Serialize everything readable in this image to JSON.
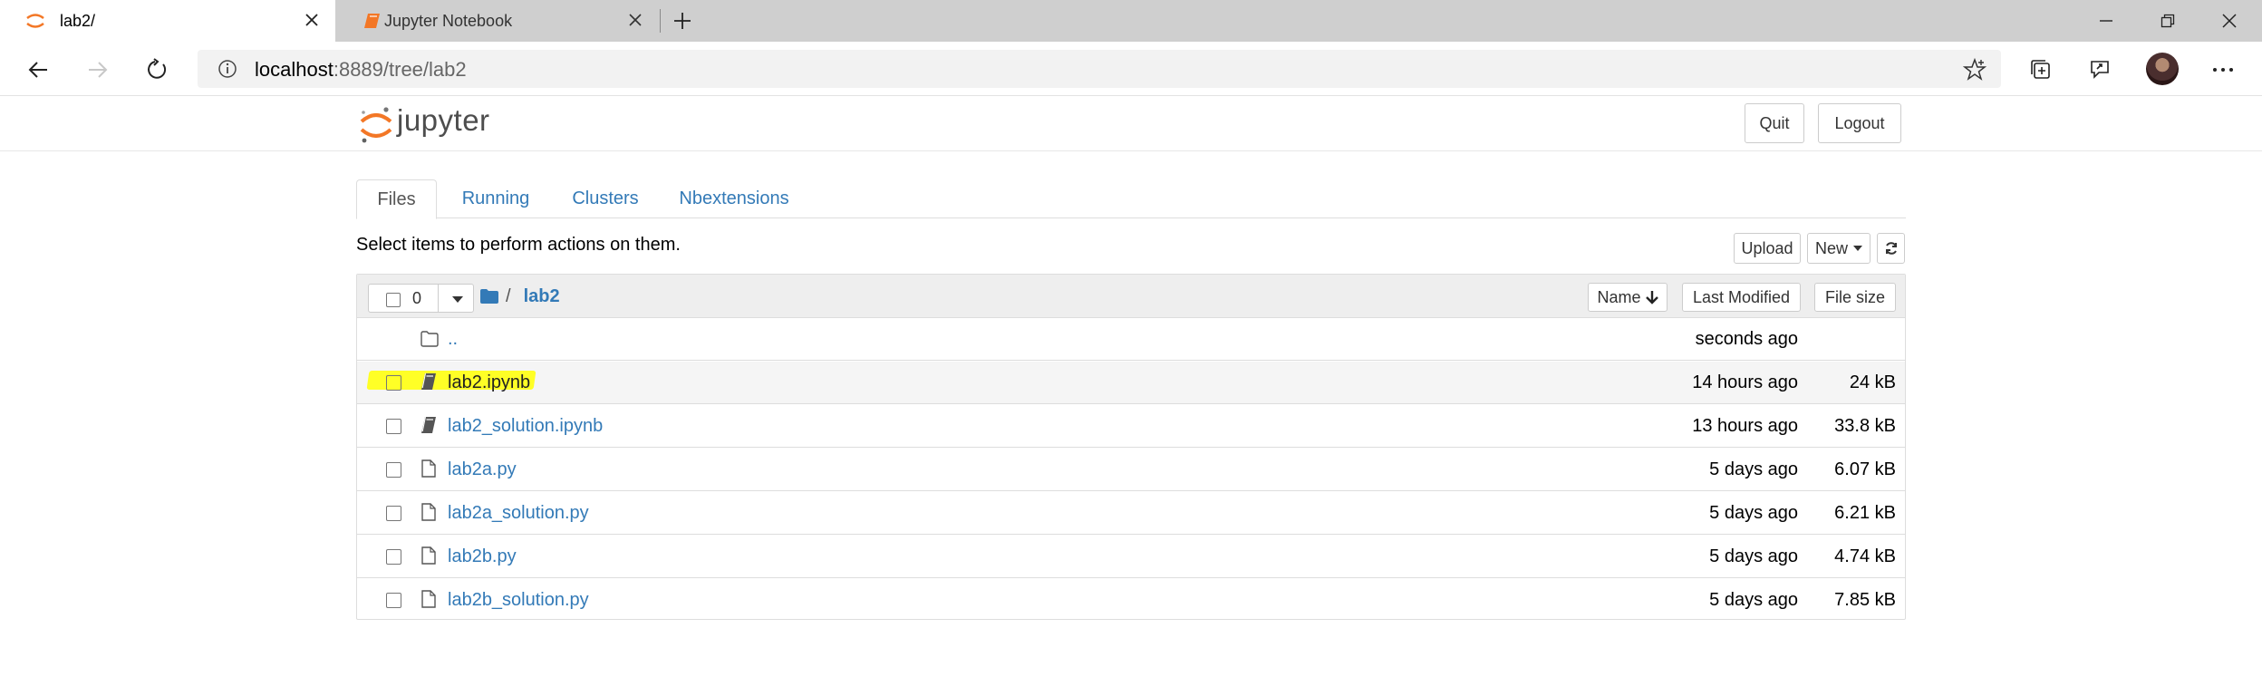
{
  "browser": {
    "tabs": [
      {
        "title": "lab2/",
        "active": true
      },
      {
        "title": "Jupyter Notebook",
        "active": false
      }
    ],
    "url_host": "localhost",
    "url_rest": ":8889/tree/lab2"
  },
  "jupyter": {
    "logo_text": "jupyter",
    "quit_label": "Quit",
    "logout_label": "Logout",
    "tabs": [
      "Files",
      "Running",
      "Clusters",
      "Nbextensions"
    ],
    "active_tab": "Files",
    "select_hint": "Select items to perform actions on them.",
    "upload_label": "Upload",
    "new_label": "New",
    "selected_count": "0",
    "breadcrumb_sep": "/",
    "breadcrumb_dir": "lab2",
    "sort_name_label": "Name",
    "sort_modified_label": "Last Modified",
    "sort_size_label": "File size",
    "files": [
      {
        "name": "..",
        "type": "folder",
        "modified": "seconds ago",
        "size": ""
      },
      {
        "name": "lab2.ipynb",
        "type": "notebook",
        "modified": "14 hours ago",
        "size": "24 kB",
        "highlighted": true
      },
      {
        "name": "lab2_solution.ipynb",
        "type": "notebook",
        "modified": "13 hours ago",
        "size": "33.8 kB"
      },
      {
        "name": "lab2a.py",
        "type": "file",
        "modified": "5 days ago",
        "size": "6.07 kB"
      },
      {
        "name": "lab2a_solution.py",
        "type": "file",
        "modified": "5 days ago",
        "size": "6.21 kB"
      },
      {
        "name": "lab2b.py",
        "type": "file",
        "modified": "5 days ago",
        "size": "4.74 kB"
      },
      {
        "name": "lab2b_solution.py",
        "type": "file",
        "modified": "5 days ago",
        "size": "7.85 kB"
      }
    ]
  },
  "colors": {
    "link": "#337ab7",
    "jupyter_orange": "#f37726",
    "highlight": "#ffff1a"
  },
  "icons": [
    "jupyter-favicon",
    "notebook-favicon",
    "close-icon",
    "plus-icon",
    "minimize-icon",
    "restore-icon",
    "back-icon",
    "forward-icon",
    "refresh-icon",
    "info-icon",
    "star-icon",
    "collections-icon",
    "share-icon",
    "more-icon",
    "folder-icon",
    "file-icon",
    "notebook-icon",
    "arrow-down-icon",
    "caret-down-icon"
  ]
}
